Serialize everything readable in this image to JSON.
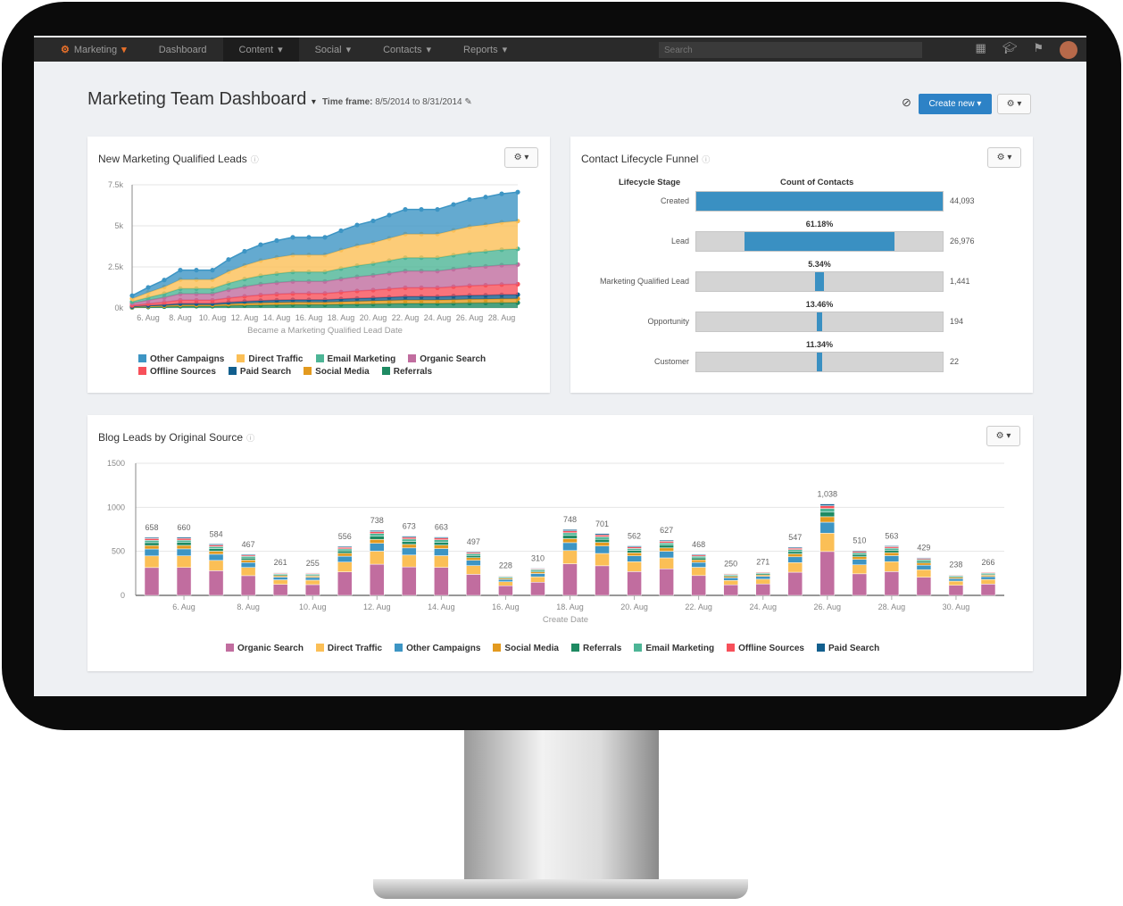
{
  "nav": {
    "brand": "Marketing",
    "items": [
      "Dashboard",
      "Content",
      "Social",
      "Contacts",
      "Reports"
    ],
    "search_placeholder": "Search"
  },
  "header": {
    "title": "Marketing Team Dashboard",
    "timeframe_label": "Time frame:",
    "timeframe": "8/5/2014 to 8/31/2014",
    "create_label": "Create new"
  },
  "colors": {
    "Other Campaigns": "#3d95c4",
    "Direct Traffic": "#fbbf56",
    "Email Marketing": "#4db596",
    "Organic Search": "#c16d9f",
    "Offline Sources": "#f7505a",
    "Paid Search": "#125f8e",
    "Social Media": "#e39a1f",
    "Referrals": "#1e8a62"
  },
  "mql": {
    "title": "New Marketing Qualified Leads",
    "chart_data": {
      "type": "area",
      "stacked": true,
      "xlabel": "Became a Marketing Qualified Lead Date",
      "ylim": [
        0,
        7500
      ],
      "yticks": [
        "0k",
        "2.5k",
        "5k",
        "7.5k"
      ],
      "ytick_values": [
        0,
        2500,
        5000,
        7500
      ],
      "x": [
        "5. Aug",
        "6. Aug",
        "7. Aug",
        "8. Aug",
        "9. Aug",
        "10. Aug",
        "11. Aug",
        "12. Aug",
        "13. Aug",
        "14. Aug",
        "15. Aug",
        "16. Aug",
        "17. Aug",
        "18. Aug",
        "19. Aug",
        "20. Aug",
        "21. Aug",
        "22. Aug",
        "23. Aug",
        "24. Aug",
        "25. Aug",
        "26. Aug",
        "27. Aug",
        "28. Aug",
        "29. Aug"
      ],
      "xtick_labels": [
        "6. Aug",
        "8. Aug",
        "10. Aug",
        "12. Aug",
        "14. Aug",
        "16. Aug",
        "18. Aug",
        "20. Aug",
        "22. Aug",
        "24. Aug",
        "26. Aug",
        "28. Aug"
      ],
      "legend": [
        "Other Campaigns",
        "Direct Traffic",
        "Email Marketing",
        "Organic Search",
        "Offline Sources",
        "Paid Search",
        "Social Media",
        "Referrals"
      ],
      "series": [
        {
          "name": "Referrals",
          "values": [
            34,
            56,
            77,
            104,
            104,
            104,
            133,
            155,
            173,
            185,
            194,
            194,
            194,
            212,
            227,
            239,
            254,
            270,
            270,
            270,
            284,
            297,
            304,
            313,
            317
          ]
        },
        {
          "name": "Social Media",
          "values": [
            26,
            44,
            60,
            81,
            81,
            81,
            103,
            121,
            135,
            144,
            151,
            151,
            151,
            165,
            177,
            186,
            198,
            210,
            210,
            210,
            221,
            231,
            236,
            243,
            247
          ]
        },
        {
          "name": "Paid Search",
          "values": [
            26,
            44,
            60,
            81,
            81,
            81,
            103,
            121,
            135,
            144,
            151,
            151,
            151,
            165,
            177,
            186,
            198,
            210,
            210,
            210,
            221,
            231,
            236,
            243,
            247
          ]
        },
        {
          "name": "Offline Sources",
          "values": [
            68,
            113,
            153,
            207,
            207,
            207,
            266,
            311,
            347,
            369,
            387,
            387,
            387,
            423,
            455,
            477,
            509,
            540,
            540,
            540,
            567,
            594,
            608,
            626,
            635
          ]
        },
        {
          "name": "Organic Search",
          "values": [
            128,
            213,
            289,
            391,
            391,
            391,
            502,
            587,
            655,
            697,
            731,
            731,
            731,
            799,
            859,
            901,
            961,
            1020,
            1020,
            1020,
            1071,
            1122,
            1148,
            1182,
            1199
          ]
        },
        {
          "name": "Email Marketing",
          "values": [
            101,
            169,
            230,
            311,
            311,
            311,
            398,
            466,
            520,
            554,
            581,
            581,
            581,
            635,
            682,
            716,
            763,
            810,
            810,
            810,
            851,
            891,
            911,
            938,
            952
          ]
        },
        {
          "name": "Direct Traffic",
          "values": [
            180,
            300,
            408,
            552,
            552,
            552,
            708,
            828,
            924,
            984,
            1032,
            1032,
            1032,
            1128,
            1212,
            1272,
            1356,
            1440,
            1440,
            1440,
            1512,
            1584,
            1620,
            1668,
            1692
          ]
        },
        {
          "name": "Other Campaigns",
          "values": [
            188,
            313,
            425,
            575,
            575,
            575,
            738,
            863,
            963,
            1025,
            1075,
            1075,
            1075,
            1175,
            1263,
            1325,
            1413,
            1500,
            1500,
            1500,
            1575,
            1650,
            1688,
            1738,
            1763
          ]
        }
      ]
    }
  },
  "funnel": {
    "title": "Contact Lifecycle Funnel",
    "col_stage": "Lifecycle Stage",
    "col_count": "Count of Contacts",
    "stages": [
      {
        "label": "Created",
        "count": "44,093",
        "value": 44093,
        "conversion": ""
      },
      {
        "label": "Lead",
        "count": "26,976",
        "value": 26976,
        "conversion": "61.18%"
      },
      {
        "label": "Marketing Qualified Lead",
        "count": "1,441",
        "value": 1441,
        "conversion": "5.34%"
      },
      {
        "label": "Opportunity",
        "count": "194",
        "value": 194,
        "conversion": "13.46%"
      },
      {
        "label": "Customer",
        "count": "22",
        "value": 22,
        "conversion": "11.34%"
      }
    ]
  },
  "blog": {
    "title": "Blog Leads by Original Source",
    "chart_data": {
      "type": "bar",
      "stacked": true,
      "xlabel": "Create Date",
      "ylim": [
        0,
        1500
      ],
      "yticks": [
        "0",
        "500",
        "1000",
        "1500"
      ],
      "ytick_values": [
        0,
        500,
        1000,
        1500
      ],
      "categories": [
        "5. Aug",
        "6. Aug",
        "7. Aug",
        "8. Aug",
        "9. Aug",
        "10. Aug",
        "11. Aug",
        "12. Aug",
        "13. Aug",
        "14. Aug",
        "15. Aug",
        "16. Aug",
        "17. Aug",
        "18. Aug",
        "19. Aug",
        "20. Aug",
        "21. Aug",
        "22. Aug",
        "23. Aug",
        "24. Aug",
        "25. Aug",
        "26. Aug",
        "27. Aug",
        "28. Aug",
        "29. Aug",
        "30. Aug",
        "31. Aug"
      ],
      "xtick_labels": [
        "6. Aug",
        "8. Aug",
        "10. Aug",
        "12. Aug",
        "14. Aug",
        "16. Aug",
        "18. Aug",
        "20. Aug",
        "22. Aug",
        "24. Aug",
        "26. Aug",
        "28. Aug",
        "30. Aug"
      ],
      "totals": [
        "658",
        "660",
        "584",
        "467",
        "261",
        "255",
        "556",
        "738",
        "673",
        "663",
        "497",
        "228",
        "310",
        "748",
        "701",
        "562",
        "627",
        "468",
        "250",
        "271",
        "547",
        "1,038",
        "510",
        "563",
        "429",
        "238",
        "266"
      ],
      "legend": [
        "Organic Search",
        "Direct Traffic",
        "Other Campaigns",
        "Social Media",
        "Referrals",
        "Email Marketing",
        "Offline Sources",
        "Paid Search"
      ],
      "series": [
        {
          "name": "Organic Search",
          "values": [
            316,
            317,
            280,
            224,
            125,
            122,
            267,
            354,
            323,
            318,
            239,
            109,
            149,
            359,
            336,
            270,
            301,
            225,
            120,
            130,
            263,
            498,
            245,
            270,
            206,
            114,
            128
          ]
        },
        {
          "name": "Direct Traffic",
          "values": [
            132,
            132,
            117,
            93,
            52,
            51,
            111,
            148,
            135,
            133,
            99,
            46,
            62,
            150,
            140,
            112,
            125,
            94,
            50,
            54,
            109,
            208,
            102,
            113,
            86,
            48,
            53
          ]
        },
        {
          "name": "Other Campaigns",
          "values": [
            79,
            79,
            70,
            56,
            31,
            31,
            67,
            89,
            81,
            80,
            60,
            27,
            37,
            90,
            84,
            67,
            75,
            56,
            30,
            33,
            66,
            125,
            61,
            68,
            51,
            29,
            32
          ]
        },
        {
          "name": "Social Media",
          "values": [
            39,
            40,
            35,
            28,
            16,
            15,
            33,
            44,
            40,
            40,
            30,
            14,
            19,
            45,
            42,
            34,
            38,
            28,
            15,
            16,
            33,
            62,
            31,
            34,
            26,
            14,
            16
          ]
        },
        {
          "name": "Referrals",
          "values": [
            33,
            33,
            29,
            23,
            13,
            13,
            28,
            37,
            34,
            33,
            25,
            11,
            16,
            37,
            35,
            28,
            31,
            23,
            13,
            14,
            27,
            52,
            26,
            28,
            21,
            12,
            13
          ]
        },
        {
          "name": "Email Marketing",
          "values": [
            26,
            26,
            23,
            19,
            10,
            10,
            22,
            30,
            27,
            27,
            20,
            9,
            12,
            30,
            28,
            22,
            25,
            19,
            10,
            11,
            22,
            42,
            20,
            23,
            17,
            10,
            11
          ]
        },
        {
          "name": "Offline Sources",
          "values": [
            20,
            20,
            18,
            14,
            8,
            8,
            17,
            22,
            20,
            20,
            15,
            7,
            9,
            22,
            21,
            17,
            19,
            14,
            8,
            8,
            16,
            31,
            15,
            17,
            13,
            7,
            8
          ]
        },
        {
          "name": "Paid Search",
          "values": [
            13,
            13,
            12,
            10,
            6,
            5,
            11,
            14,
            13,
            12,
            9,
            5,
            6,
            15,
            15,
            12,
            13,
            9,
            4,
            5,
            11,
            20,
            10,
            10,
            9,
            4,
            5
          ]
        }
      ]
    }
  }
}
